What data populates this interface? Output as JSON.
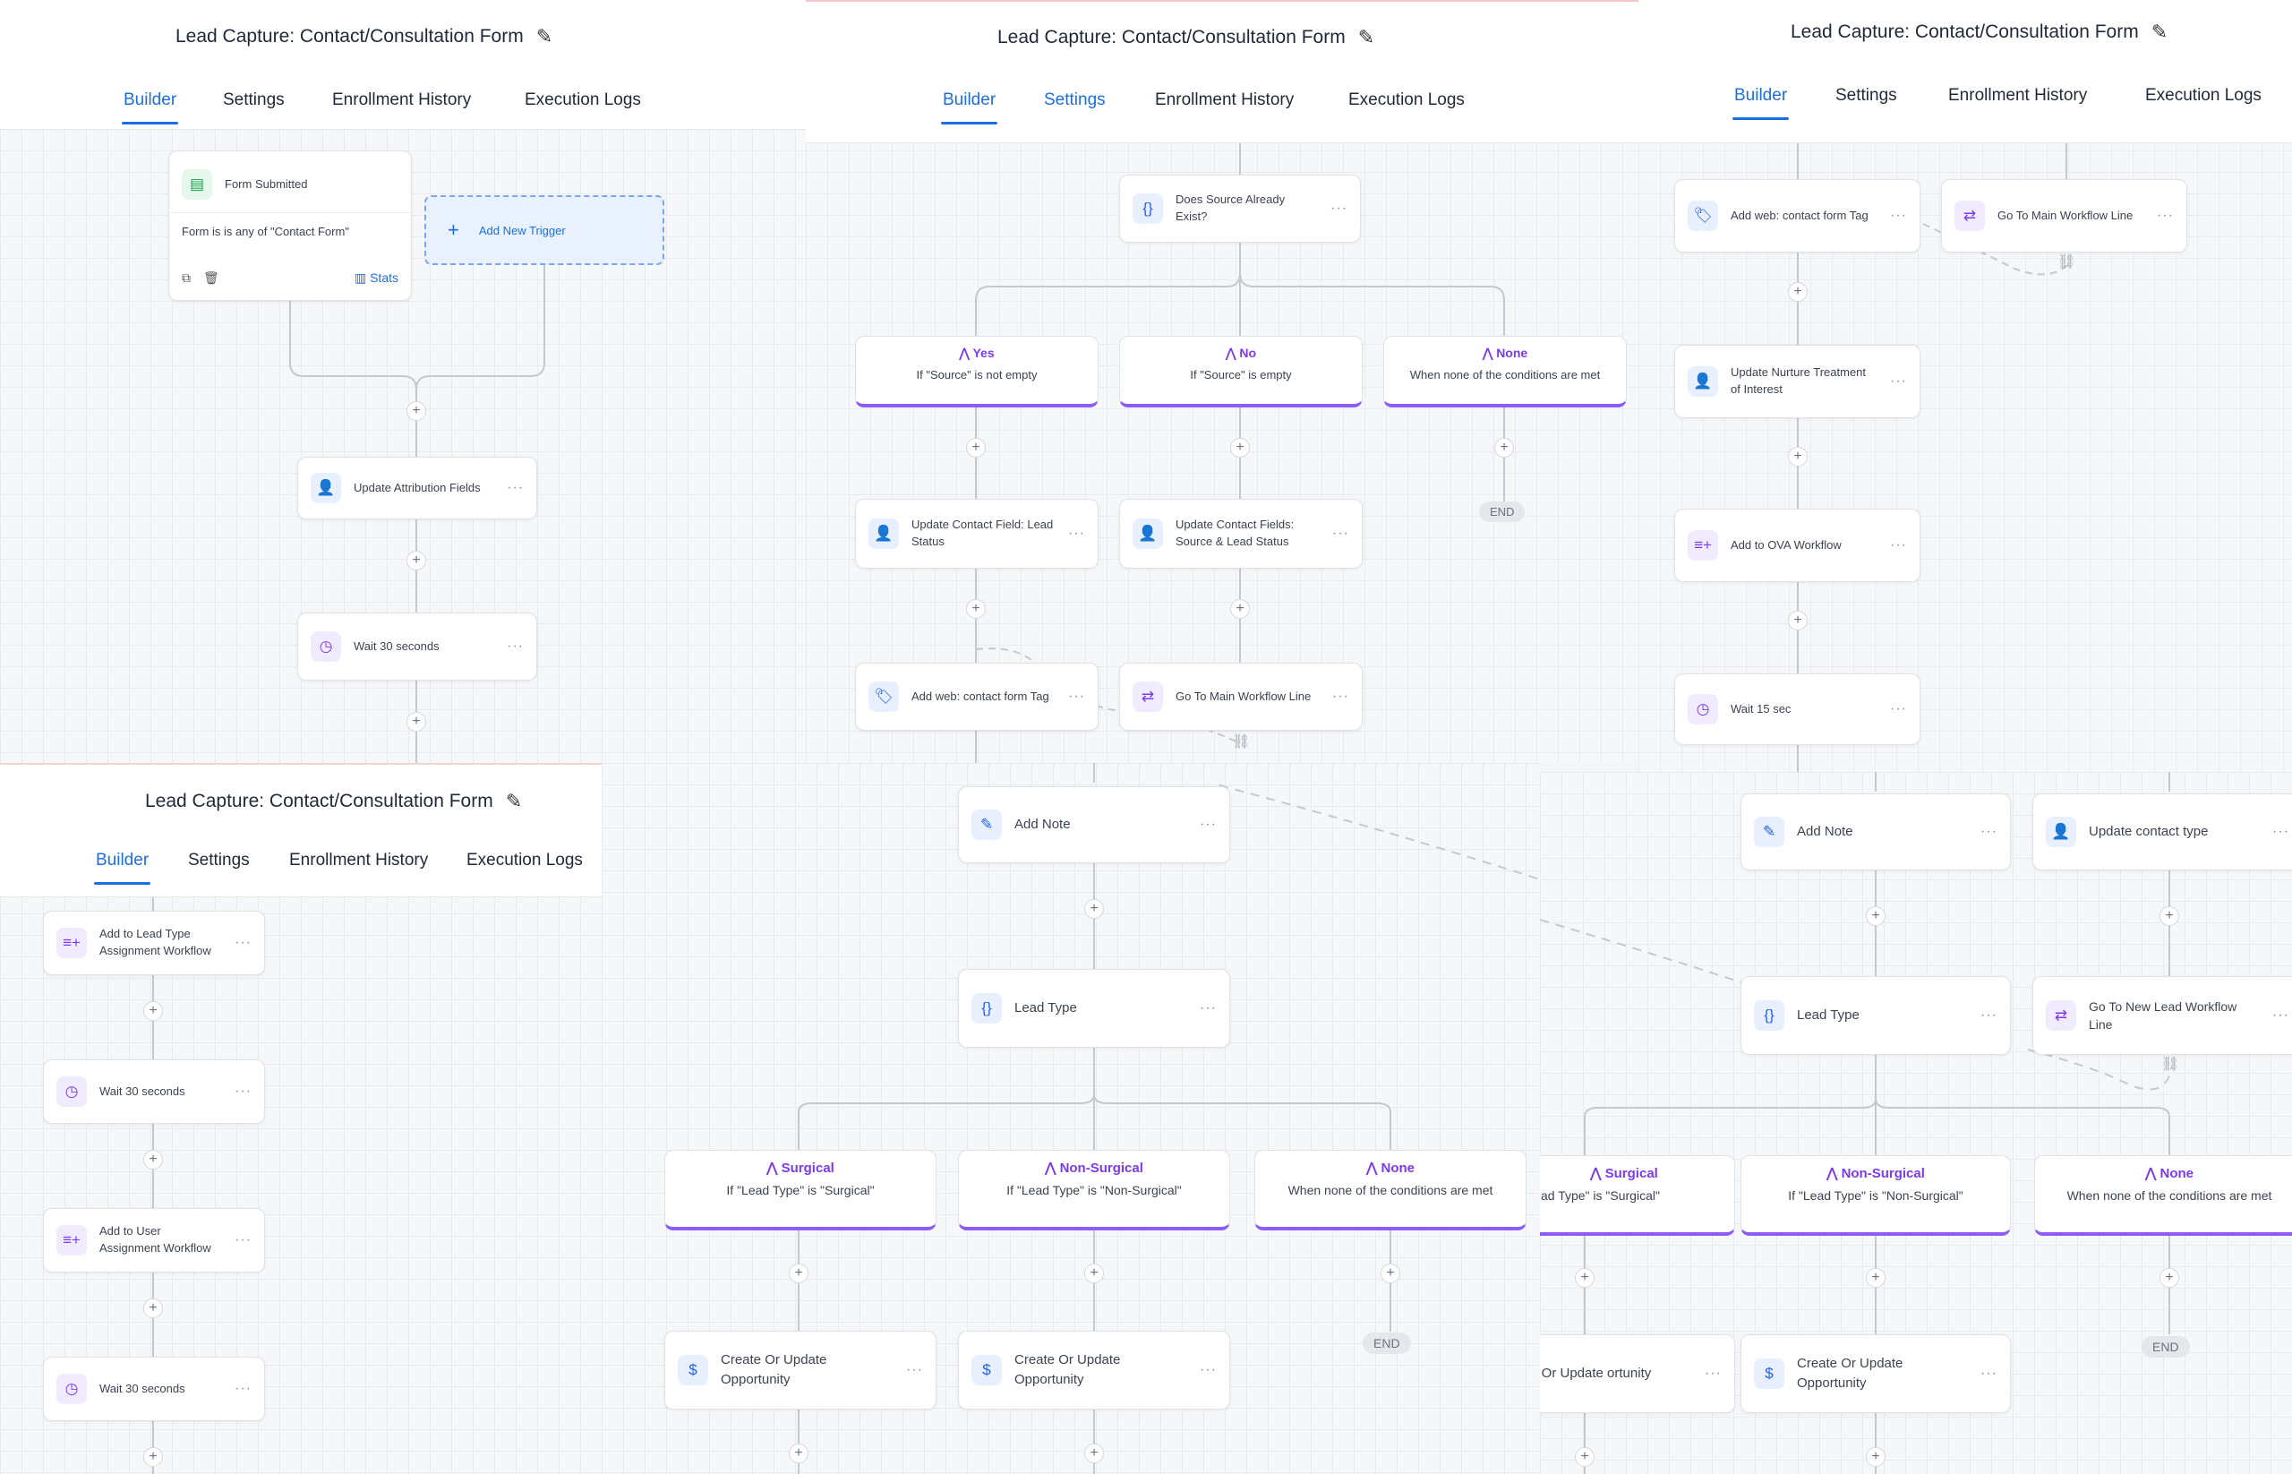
{
  "workflow_title": "Lead Capture: Contact/Consultation Form",
  "tabs": {
    "builder": "Builder",
    "settings": "Settings",
    "enrollment": "Enrollment History",
    "logs": "Execution Logs"
  },
  "nodes": {
    "form_submitted": "Form Submitted",
    "form_filter": "Form is is any of \"Contact Form\"",
    "stats": "Stats",
    "add_trigger": "Add New Trigger",
    "update_attribution": "Update Attribution Fields",
    "wait_30": "Wait 30 seconds",
    "source_exists": "Does Source Already Exist?",
    "yes": "Yes",
    "yes_desc": "If \"Source\" is not empty",
    "no": "No",
    "no_desc": "If \"Source\" is empty",
    "none": "None",
    "none_desc": "When none of the conditions are met",
    "update_lead_status": "Update Contact Field: Lead Status",
    "update_source_status": "Update Contact Fields: Source & Lead Status",
    "add_tag": "Add web: contact form Tag",
    "goto_main": "Go To Main Workflow Line",
    "end": "END",
    "update_nurture": "Update Nurture Treatment of Interest",
    "add_ova": "Add to OVA Workflow",
    "wait_15": "Wait 15 sec",
    "add_lead_type_wf": "Add to Lead Type Assignment Workflow",
    "add_user_wf": "Add to User Assignment Workflow",
    "add_note": "Add Note",
    "lead_type": "Lead Type",
    "update_contact_type": "Update contact type",
    "goto_new_lead": "Go To New Lead Workflow Line",
    "surgical": "Surgical",
    "surgical_desc": "If \"Lead Type\" is \"Surgical\"",
    "surgical_desc_clip": "ad Type\" is \"Surgical\"",
    "nonsurgical": "Non-Surgical",
    "nonsurgical_desc": "If \"Lead Type\" is \"Non-Surgical\"",
    "create_opp": "Create Or Update Opportunity",
    "create_opp_clip": "te Or Update ortunity"
  },
  "colors": {
    "accent": "#1d6fe0",
    "branch": "#8b5cf6"
  }
}
